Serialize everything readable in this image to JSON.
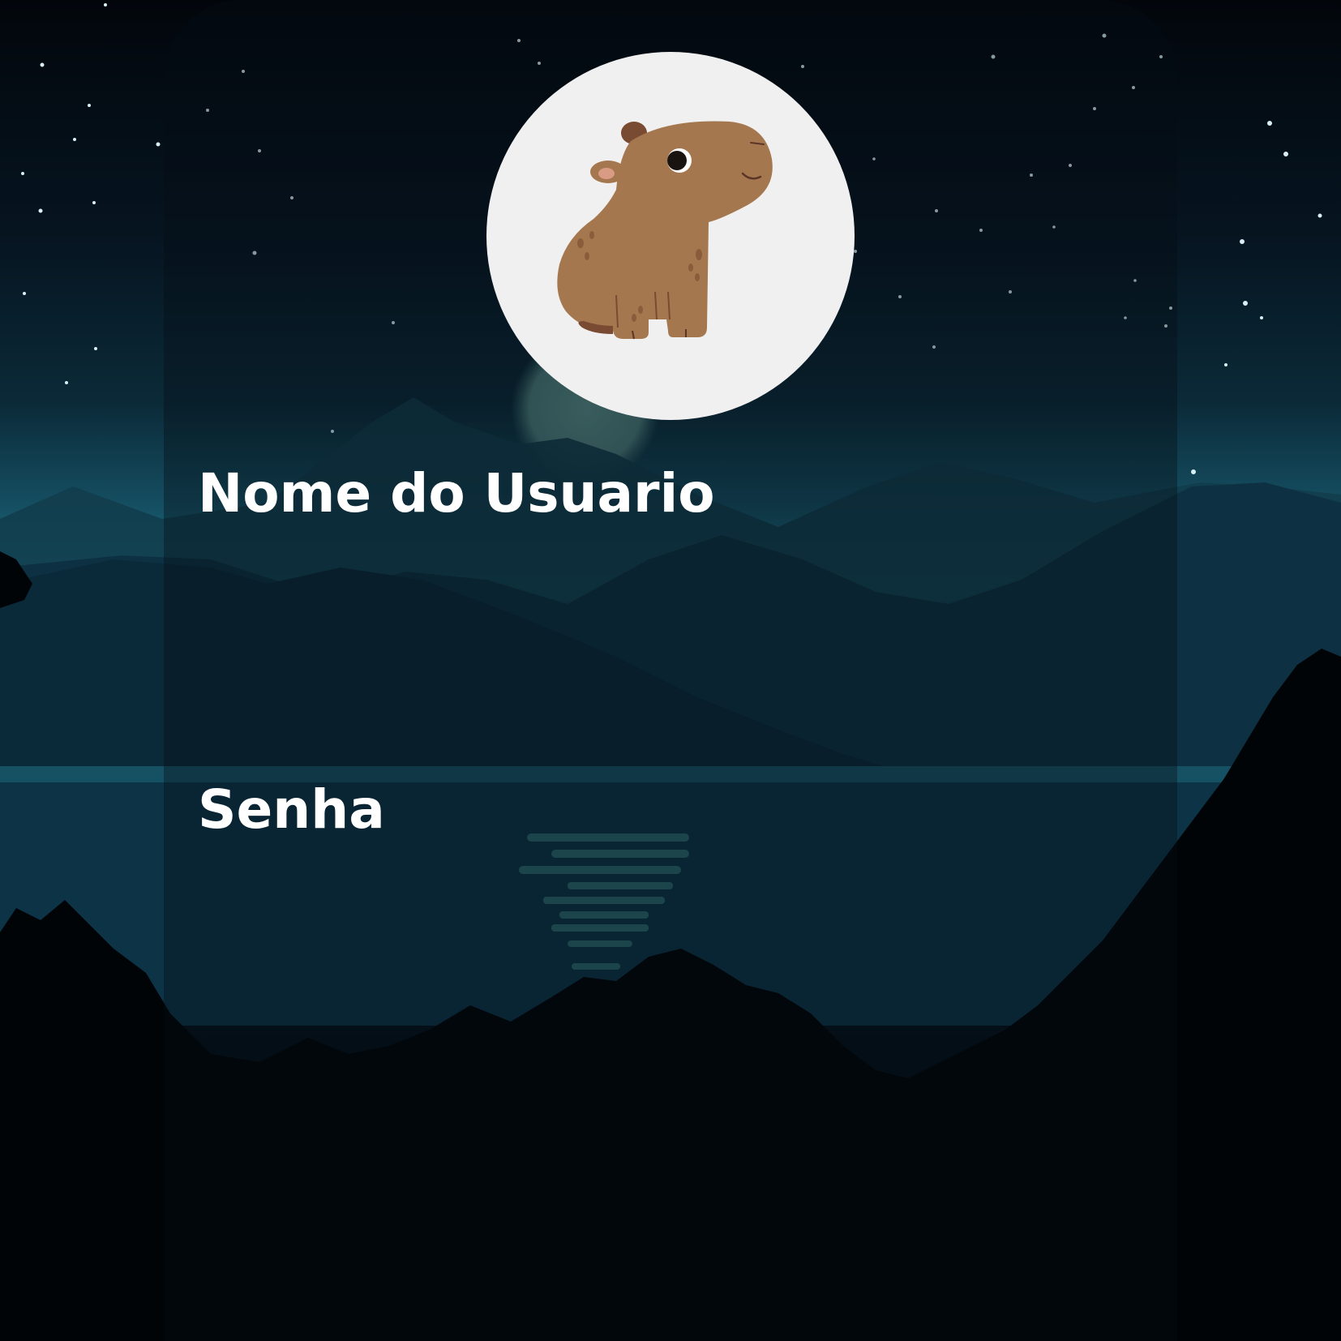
{
  "background": {
    "scene": "night-lake-mountains",
    "colors": {
      "sky_top": "#03080f",
      "sky_mid": "#0b2a38",
      "sky_horizon": "#2a8fa0",
      "water": "#0c3a4c",
      "foliage": "#010407",
      "moon": "#4f7f7d"
    }
  },
  "card": {
    "color": "#06141d"
  },
  "avatar": {
    "icon": "capybara-icon",
    "background": "#f0f0f0",
    "body_color": "#a5774f",
    "dark_color": "#7a4b33"
  },
  "login": {
    "username_label": "Nome do Usuario",
    "username_value": "",
    "password_label": "Senha",
    "password_value": ""
  }
}
